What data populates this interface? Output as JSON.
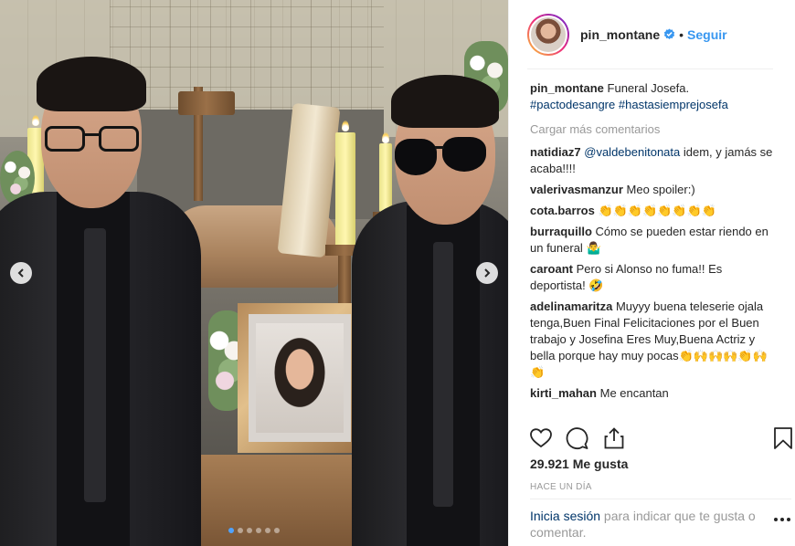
{
  "post": {
    "username": "pin_montane",
    "verified": true,
    "separator": "•",
    "follow_label": "Seguir",
    "caption_user": "pin_montane",
    "caption_text": "Funeral Josefa.",
    "caption_tags": [
      "#pactodesangre",
      "#hastasiemprejosefa"
    ],
    "load_more_label": "Cargar más comentarios",
    "likes_label": "29.921 Me gusta",
    "time_label": "HACE UN DÍA",
    "login_link": "Inicia sesión",
    "login_rest": " para indicar que te gusta o comentar."
  },
  "comments": [
    {
      "user": "natidiaz7",
      "mention": "@valdebenitonata",
      "text": " idem, y jamás se acaba!!!!",
      "emoji": ""
    },
    {
      "user": "valerivasmanzur",
      "mention": "",
      "text": "Meo spoiler:)",
      "emoji": ""
    },
    {
      "user": "cota.barros",
      "mention": "",
      "text": "",
      "emoji": "👏👏👏👏👏👏👏👏"
    },
    {
      "user": "burraquillo",
      "mention": "",
      "text": "Cómo se pueden estar riendo en un funeral ",
      "emoji": "🤷‍♂️"
    },
    {
      "user": "caroant",
      "mention": "",
      "text": "Pero si Alonso no fuma!! Es deportista! ",
      "emoji": "🤣"
    },
    {
      "user": "adelinamaritza",
      "mention": "",
      "text": "Muyyy buena teleserie ojala tenga,Buen Final Felicitaciones por el Buen trabajo y Josefina Eres Muy,Buena Actriz y bella porque hay muy pocas",
      "emoji": "👏🙌🙌🙌👏🙌👏"
    },
    {
      "user": "kirti_mahan",
      "mention": "",
      "text": "Me encantan",
      "emoji": ""
    }
  ],
  "carousel": {
    "slide_count": 6,
    "active_index": 0
  },
  "icons": {
    "prev": "chevron-left-icon",
    "next": "chevron-right-icon",
    "like": "heart-icon",
    "comment": "comment-bubble-icon",
    "share": "share-icon",
    "save": "bookmark-icon",
    "more": "more-options-icon",
    "verified": "verified-badge-icon"
  },
  "colors": {
    "link_blue": "#3897f0",
    "dark_link": "#003569",
    "muted": "#999999",
    "text": "#262626"
  }
}
